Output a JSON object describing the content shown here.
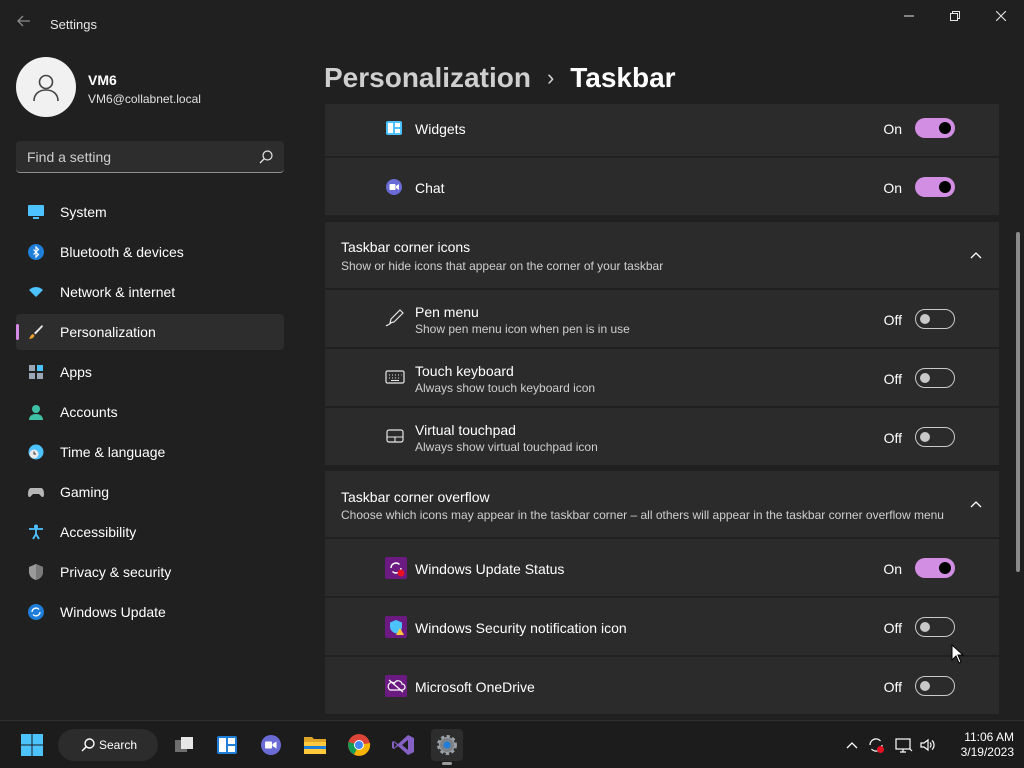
{
  "window": {
    "title": "Settings"
  },
  "profile": {
    "name": "VM6",
    "email": "VM6@collabnet.local"
  },
  "search": {
    "placeholder": "Find a setting"
  },
  "nav": {
    "items": [
      {
        "label": "System",
        "icon": "monitor-icon",
        "active": false
      },
      {
        "label": "Bluetooth & devices",
        "icon": "bluetooth-icon",
        "active": false
      },
      {
        "label": "Network & internet",
        "icon": "wifi-icon",
        "active": false
      },
      {
        "label": "Personalization",
        "icon": "brush-icon",
        "active": true
      },
      {
        "label": "Apps",
        "icon": "apps-icon",
        "active": false
      },
      {
        "label": "Accounts",
        "icon": "person-icon",
        "active": false
      },
      {
        "label": "Time & language",
        "icon": "clock-globe-icon",
        "active": false
      },
      {
        "label": "Gaming",
        "icon": "gamepad-icon",
        "active": false
      },
      {
        "label": "Accessibility",
        "icon": "accessibility-icon",
        "active": false
      },
      {
        "label": "Privacy & security",
        "icon": "shield-icon",
        "active": false
      },
      {
        "label": "Windows Update",
        "icon": "update-icon",
        "active": false
      }
    ]
  },
  "breadcrumb": {
    "parent": "Personalization",
    "separator": "›",
    "current": "Taskbar"
  },
  "taskbar_items": {
    "widgets": {
      "label": "Widgets",
      "state": "On"
    },
    "chat": {
      "label": "Chat",
      "state": "On"
    }
  },
  "corner_icons": {
    "title": "Taskbar corner icons",
    "subtitle": "Show or hide icons that appear on the corner of your taskbar",
    "items": [
      {
        "title": "Pen menu",
        "subtitle": "Show pen menu icon when pen is in use",
        "state": "Off"
      },
      {
        "title": "Touch keyboard",
        "subtitle": "Always show touch keyboard icon",
        "state": "Off"
      },
      {
        "title": "Virtual touchpad",
        "subtitle": "Always show virtual touchpad icon",
        "state": "Off"
      }
    ]
  },
  "corner_overflow": {
    "title": "Taskbar corner overflow",
    "subtitle": "Choose which icons may appear in the taskbar corner – all others will appear in the taskbar corner overflow menu",
    "items": [
      {
        "title": "Windows Update Status",
        "state": "On"
      },
      {
        "title": "Windows Security notification icon",
        "state": "Off"
      },
      {
        "title": "Microsoft OneDrive",
        "state": "Off"
      }
    ]
  },
  "taskbar": {
    "search_label": "Search",
    "time": "11:06 AM",
    "date": "3/19/2023"
  },
  "colors": {
    "accent": "#d28ee2",
    "background": "#202020",
    "card": "#2b2b2b"
  }
}
